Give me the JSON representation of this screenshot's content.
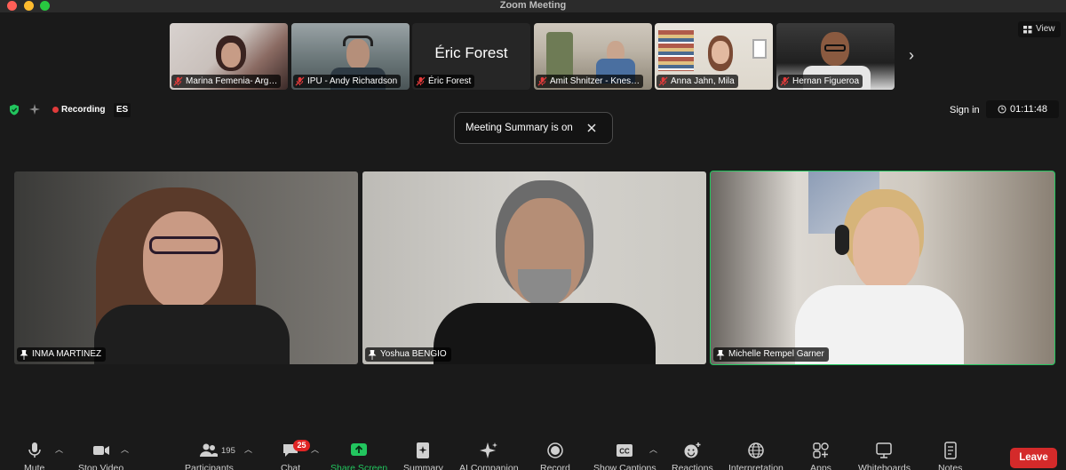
{
  "window": {
    "title": "Zoom Meeting"
  },
  "thumbnails": [
    {
      "name": "Marina Femenia- Arg…",
      "muted": true
    },
    {
      "name": "IPU - Andy Richardson",
      "muted": true
    },
    {
      "name": "Éric Forest",
      "muted": true,
      "video_off": true,
      "display_name": "Éric Forest"
    },
    {
      "name": "Amit Shnitzer - Knes…",
      "muted": true
    },
    {
      "name": "Anna Jahn, Mila",
      "muted": true
    },
    {
      "name": "Hernan Figueroa",
      "muted": true
    }
  ],
  "view_button": {
    "label": "View"
  },
  "status": {
    "recording_label": "Recording",
    "language_badge": "ES",
    "signin_label": "Sign in",
    "timer": "01:11:48"
  },
  "toast": {
    "text": "Meeting Summary is on"
  },
  "main_tiles": [
    {
      "name": "INMA MARTINEZ",
      "active": false
    },
    {
      "name": "Yoshua BENGIO",
      "active": false
    },
    {
      "name": "Michelle Rempel Garner",
      "active": true
    }
  ],
  "toolbar": {
    "mute": "Mute",
    "stop_video": "Stop Video",
    "participants": "Participants",
    "participant_count": "195",
    "chat": "Chat",
    "chat_unread": "25",
    "share_screen": "Share Screen",
    "summary": "Summary",
    "ai_companion": "AI Companion",
    "record": "Record",
    "show_captions": "Show Captions",
    "reactions": "Reactions",
    "interpretation": "Interpretation",
    "apps": "Apps",
    "whiteboards": "Whiteboards",
    "notes": "Notes",
    "leave": "Leave"
  },
  "colors": {
    "active_speaker": "#22c55e",
    "share_screen": "#22c55e",
    "leave": "#d42a2a",
    "recording": "#e03b3b",
    "mute_icon": "#e23b3b"
  }
}
